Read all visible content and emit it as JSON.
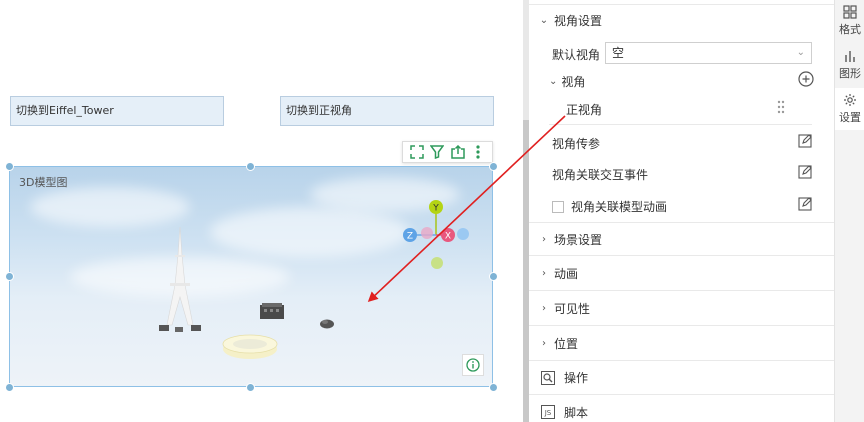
{
  "canvas": {
    "button_eiffel_label": "切换到Eiffel_Tower",
    "button_front_label": "切换到正视角",
    "scene_title": "3D模型图",
    "axes": {
      "y": "Y",
      "z": "Z",
      "x": "X"
    }
  },
  "panel": {
    "view_settings": "视角设置",
    "default_view_label": "默认视角",
    "default_view_value": "空",
    "views_label": "视角",
    "view_item": "正视角",
    "view_param": "视角传参",
    "view_event": "视角关联交互事件",
    "view_anim": "视角关联模型动画",
    "scene_settings": "场景设置",
    "animation": "动画",
    "visibility": "可见性",
    "position": "位置",
    "operation": "操作",
    "script": "脚本"
  },
  "side_tabs": {
    "format": "格式",
    "shape": "图形",
    "settings": "设置"
  },
  "colors": {
    "accent_green": "#2e9a5b",
    "annotation_red": "#e02020",
    "handle_blue": "#7fb3d5"
  }
}
